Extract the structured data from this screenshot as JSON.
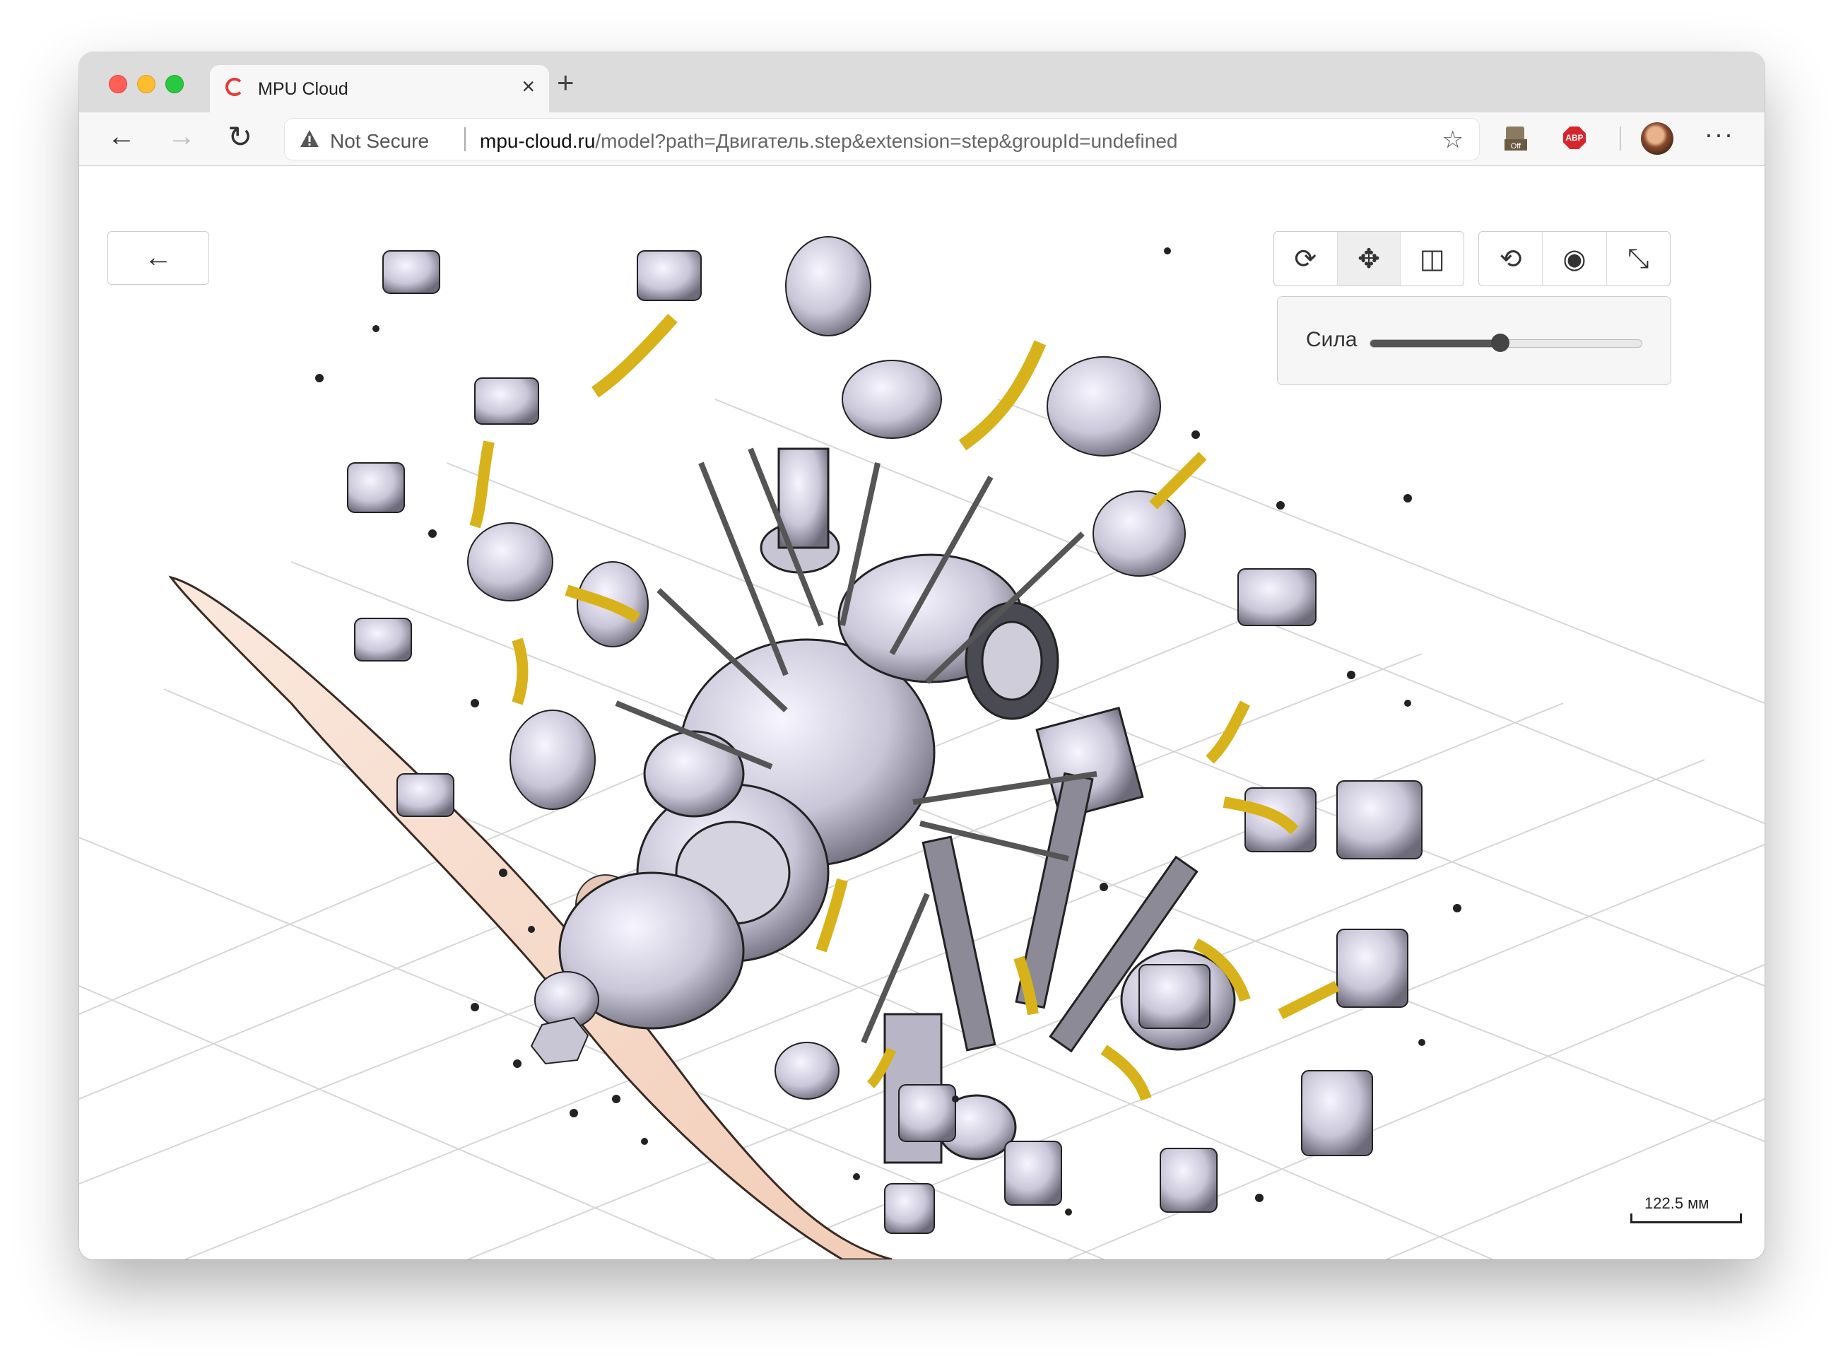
{
  "browser": {
    "tab": {
      "title": "MPU Cloud"
    },
    "toolbar": {
      "security_label": "Not Secure",
      "url_host": "mpu-cloud.ru",
      "url_path": "/model?path=Двигатель.step&extension=step&groupId=undefined",
      "extension_badge": "Off",
      "adblock_label": "ABP"
    }
  },
  "viewer": {
    "toolbar_group_1": [
      "rotate-icon",
      "move-icon",
      "section-icon"
    ],
    "toolbar_group_2": [
      "reset-view-icon",
      "visibility-icon",
      "explode-icon"
    ],
    "active_tool": "move-icon",
    "force_panel": {
      "label": "Сила",
      "value": 0.48
    },
    "scale": {
      "label": "122.5 мм"
    }
  },
  "colors": {
    "accent_yellow": "#d8b21a",
    "propeller": "#f6dccb",
    "grid": "#d8d8d8"
  }
}
